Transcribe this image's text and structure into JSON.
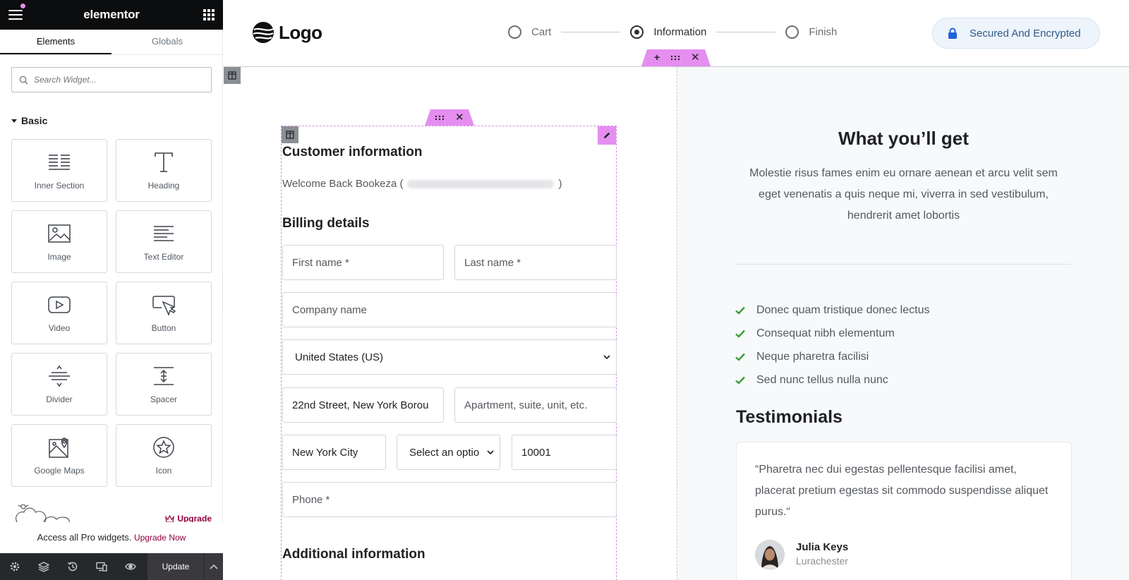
{
  "panel": {
    "brand": "elementor",
    "tabs": [
      "Elements",
      "Globals"
    ],
    "search_placeholder": "Search Widget...",
    "category": "Basic",
    "widgets": [
      {
        "label": "Inner Section",
        "icon": "inner-section-icon"
      },
      {
        "label": "Heading",
        "icon": "heading-icon"
      },
      {
        "label": "Image",
        "icon": "image-icon"
      },
      {
        "label": "Text Editor",
        "icon": "text-editor-icon"
      },
      {
        "label": "Video",
        "icon": "video-icon"
      },
      {
        "label": "Button",
        "icon": "button-icon"
      },
      {
        "label": "Divider",
        "icon": "divider-icon"
      },
      {
        "label": "Spacer",
        "icon": "spacer-icon"
      },
      {
        "label": "Google Maps",
        "icon": "google-maps-icon"
      },
      {
        "label": "Icon",
        "icon": "star-icon"
      }
    ],
    "upgrade_link": "Upgrade",
    "access_text": "Access all Pro widgets.",
    "access_link": "Upgrade Now",
    "update_label": "Update",
    "footer_icons": [
      "settings-icon",
      "navigator-icon",
      "history-icon",
      "responsive-icon",
      "preview-icon"
    ]
  },
  "header": {
    "logo_text": "Logo",
    "steps": [
      {
        "label": "Cart",
        "active": false
      },
      {
        "label": "Information",
        "active": true
      },
      {
        "label": "Finish",
        "active": false
      }
    ],
    "secured": "Secured And Encrypted"
  },
  "form": {
    "customer_title": "Customer information",
    "welcome_prefix": "Welcome Back Bookeza (",
    "welcome_suffix": ")",
    "billing_title": "Billing details",
    "first_name": "First name *",
    "last_name": "Last name *",
    "company": "Company name",
    "country": "United States (US)",
    "street": "22nd Street, New York Borou",
    "apartment": "Apartment, suite, unit, etc.",
    "city": "New York City",
    "state": "Select an optio",
    "zip": "10001",
    "phone": "Phone *",
    "additional_title": "Additional information"
  },
  "aside": {
    "title": "What you’ll get",
    "description": "Molestie risus fames enim eu ornare aenean et arcu velit sem eget venenatis a quis neque mi, viverra in sed vestibulum, hendrerit amet lobortis",
    "benefits": [
      "Donec quam tristique donec lectus",
      "Consequat nibh elementum",
      "Neque pharetra facilisi",
      "Sed nunc tellus nulla nunc"
    ],
    "testimonials_title": "Testimonials",
    "testimonial": {
      "quote": "“Pharetra nec dui egestas pellentesque facilisi amet, placerat pretium egestas sit commodo suspendisse aliquet purus.“",
      "name": "Julia Keys",
      "location": "Lurachester"
    }
  },
  "colors": {
    "accent_pink": "#e58ef0",
    "check_green": "#3a9b3a",
    "upgrade_maroon": "#93003f",
    "secured_blue": "#1e63d6"
  }
}
